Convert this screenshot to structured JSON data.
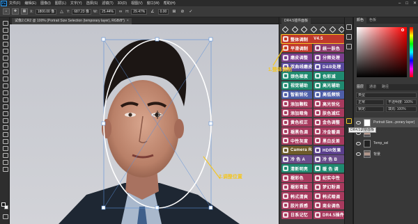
{
  "menu": {
    "logo": "Ps",
    "items": [
      "文件(F)",
      "编辑(E)",
      "图像(I)",
      "图层(L)",
      "文字(Y)",
      "选择(S)",
      "滤镜(T)",
      "3D(D)",
      "视图(V)",
      "窗口(W)",
      "帮助(H)"
    ],
    "window_controls": [
      "–",
      "□",
      "✕"
    ]
  },
  "options": {
    "x_label": "X:",
    "x_value": "1800.00 像",
    "y_label": "Y:",
    "y_value": "687.23 像",
    "w_label": "W:",
    "w_value": "25.44%",
    "h_label": "H:",
    "h_value": "29.47%",
    "angle_value": "0.00",
    "cancel_symbol": "⊘",
    "commit_symbol": "✓"
  },
  "document": {
    "tab_label": "试像2.CR2 @ 100% (Portrait Size Selection (temporary layer), RGB/8*)",
    "tab_close": "×"
  },
  "annotations": {
    "label_1": "1.整体调制",
    "label_2": "2.调整位置"
  },
  "plugin": {
    "title": "DR4.5插件面板",
    "version": "V4.5",
    "buttons": [
      {
        "label": "整体调制",
        "color": "#c0392b",
        "selected": true
      },
      {
        "label": "平滑调制",
        "color": "#c0392b"
      },
      {
        "label": "统一肤色",
        "color": "#8e3b6b"
      },
      {
        "label": "磨皮调整",
        "color": "#7b3f8f"
      },
      {
        "label": "分频处理",
        "color": "#7b3f8f"
      },
      {
        "label": "双曲线磨皮",
        "color": "#5a4a9e"
      },
      {
        "label": "D&B处理",
        "color": "#5a4a9e"
      },
      {
        "label": "颈色梯度",
        "color": "#1f8a70"
      },
      {
        "label": "色彩减",
        "color": "#1f8a70"
      },
      {
        "label": "视觉辅助",
        "color": "#1f8a70"
      },
      {
        "label": "高光辅助",
        "color": "#1f8a70"
      },
      {
        "label": "智能锐化",
        "color": "#4e5ea8"
      },
      {
        "label": "高低频锐",
        "color": "#4e5ea8"
      },
      {
        "label": "添加颗粒",
        "color": "#a83a5e"
      },
      {
        "label": "高光锐化",
        "color": "#a83a5e"
      },
      {
        "label": "添加暗角",
        "color": "#a83a5e"
      },
      {
        "label": "肤色减红",
        "color": "#a83a5e"
      },
      {
        "label": "黄色校正",
        "color": "#a83a5e"
      },
      {
        "label": "金色调整",
        "color": "#a83a5e"
      },
      {
        "label": "褪黑色调",
        "color": "#a83a5e"
      },
      {
        "label": "冷金暖调",
        "color": "#a83a5e"
      },
      {
        "label": "中性灰度",
        "color": "#a83a5e"
      },
      {
        "label": "黑白反差",
        "color": "#a83a5e"
      },
      {
        "label": "Camera Raw",
        "color": "#6e5a2a"
      },
      {
        "label": "HDR效果",
        "color": "#5a3e8c"
      },
      {
        "label": "冷 色 A",
        "color": "#6a4c8a"
      },
      {
        "label": "冷 色 B",
        "color": "#6a4c8a"
      },
      {
        "label": "清新明亮",
        "color": "#1f8a70"
      },
      {
        "label": "暖 色 调",
        "color": "#1f8a70"
      },
      {
        "label": "褪彩色",
        "color": "#a83a5e"
      },
      {
        "label": "纪实中性",
        "color": "#a83a5e"
      },
      {
        "label": "褪彩青蓝",
        "color": "#a83a5e"
      },
      {
        "label": "梦幻粉调",
        "color": "#a83a5e"
      },
      {
        "label": "韩式清爽",
        "color": "#a83a5e"
      },
      {
        "label": "韩式暗调",
        "color": "#a83a5e"
      },
      {
        "label": "胶片质感",
        "color": "#a83a5e"
      },
      {
        "label": "商业调色",
        "color": "#a83a5e"
      },
      {
        "label": "日系记忆",
        "color": "#a83a5e"
      },
      {
        "label": "DR4.5插件",
        "color": "#a83a5e"
      }
    ]
  },
  "panels": {
    "color_tabs": [
      "颜色",
      "色板"
    ],
    "layer_tabs": [
      "图层",
      "通道",
      "路径"
    ],
    "kind_filter": "类型",
    "blend_mode": "正常",
    "opacity_label": "不透明度: 100%",
    "lock_label": "锁定:",
    "fill_label": "填充: 100%",
    "tooltip": "DR4.5调整面板",
    "layers": [
      {
        "name": "Portrait Size...porary layer)",
        "thumb": "white",
        "active": true
      },
      {
        "name": "",
        "thumb": "photo"
      },
      {
        "name": "Temp_sel",
        "thumb": "dark"
      },
      {
        "name": "背景",
        "thumb": "photo"
      }
    ]
  }
}
